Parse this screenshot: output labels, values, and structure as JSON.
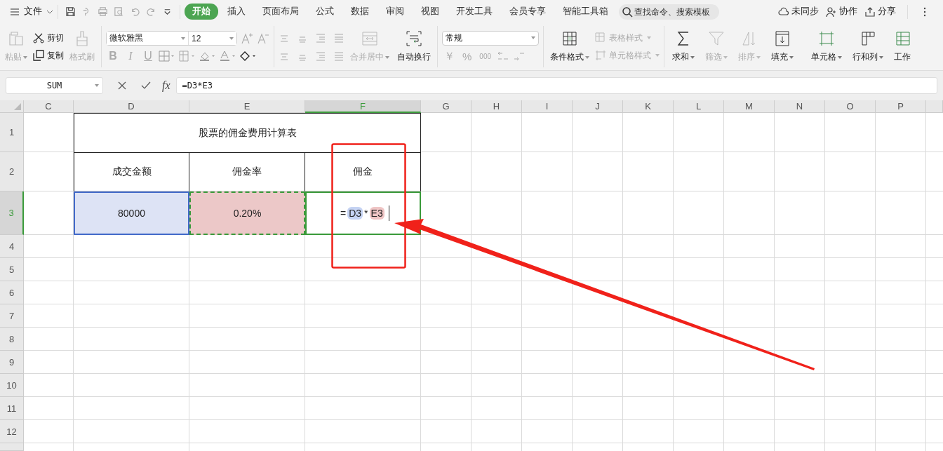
{
  "menu": {
    "label": "文件"
  },
  "tabs": [
    {
      "label": "开始",
      "selected": true
    },
    {
      "label": "插入",
      "selected": false
    },
    {
      "label": "页面布局",
      "selected": false
    },
    {
      "label": "公式",
      "selected": false
    },
    {
      "label": "数据",
      "selected": false
    },
    {
      "label": "审阅",
      "selected": false
    },
    {
      "label": "视图",
      "selected": false
    },
    {
      "label": "开发工具",
      "selected": false
    },
    {
      "label": "会员专享",
      "selected": false
    },
    {
      "label": "智能工具箱",
      "selected": false
    }
  ],
  "search": {
    "placeholder": "查找命令、搜索模板"
  },
  "actions": [
    {
      "label": "未同步"
    },
    {
      "label": "协作"
    },
    {
      "label": "分享"
    }
  ],
  "ribbon": {
    "paste": {
      "label": "粘贴",
      "disabled": true
    },
    "cut": {
      "label": "剪切",
      "disabled": false
    },
    "copy": {
      "label": "复制",
      "disabled": false
    },
    "format_painter": {
      "label": "格式刷",
      "disabled": true
    },
    "font": {
      "value": "微软雅黑"
    },
    "font_size": {
      "value": "12"
    },
    "text_styles": [
      {
        "label": "B",
        "disabled": true
      },
      {
        "label": "I",
        "disabled": true
      },
      {
        "label": "U",
        "disabled": true
      }
    ],
    "merge": {
      "label": "合并居中",
      "disabled": true
    },
    "wrap": {
      "label": "自动换行",
      "disabled": false
    },
    "number_format": {
      "value": "常规"
    },
    "number_buttons": [
      {
        "label": "￥",
        "disabled": true
      },
      {
        "label": "%",
        "disabled": true
      },
      {
        "label": "000",
        "disabled": true
      }
    ],
    "conditional_format": {
      "label": "条件格式",
      "disabled": false
    },
    "table_style": {
      "label": "表格样式",
      "disabled": true
    },
    "cell_style": {
      "label": "单元格样式",
      "disabled": true
    },
    "tools": [
      {
        "kind": "sum",
        "label": "求和",
        "disabled": false
      },
      {
        "kind": "filter",
        "label": "筛选",
        "disabled": true
      },
      {
        "kind": "sort",
        "label": "排序",
        "disabled": true
      },
      {
        "kind": "fill",
        "label": "填充",
        "disabled": false
      },
      {
        "kind": "cell",
        "label": "单元格",
        "disabled": false
      },
      {
        "kind": "rowcol",
        "label": "行和列",
        "disabled": false
      },
      {
        "kind": "sheet",
        "label": "工作",
        "disabled": false
      }
    ]
  },
  "formula_bar": {
    "name_box": "SUM",
    "function_label": "fx",
    "formula": "=D3*E3"
  },
  "sheet": {
    "columns": [
      {
        "label": "C",
        "selected": false
      },
      {
        "label": "D",
        "selected": false
      },
      {
        "label": "E",
        "selected": false
      },
      {
        "label": "F",
        "selected": true
      },
      {
        "label": "G",
        "selected": false
      },
      {
        "label": "H",
        "selected": false
      },
      {
        "label": "I",
        "selected": false
      },
      {
        "label": "J",
        "selected": false
      },
      {
        "label": "K",
        "selected": false
      },
      {
        "label": "L",
        "selected": false
      },
      {
        "label": "M",
        "selected": false
      },
      {
        "label": "N",
        "selected": false
      },
      {
        "label": "O",
        "selected": false
      },
      {
        "label": "P",
        "selected": false
      }
    ],
    "rows": [
      {
        "label": "1",
        "selected": false
      },
      {
        "label": "2",
        "selected": false
      },
      {
        "label": "3",
        "selected": true
      },
      {
        "label": "4",
        "selected": false
      },
      {
        "label": "5",
        "selected": false
      },
      {
        "label": "6",
        "selected": false
      },
      {
        "label": "7",
        "selected": false
      },
      {
        "label": "8",
        "selected": false
      },
      {
        "label": "9",
        "selected": false
      },
      {
        "label": "10",
        "selected": false
      },
      {
        "label": "11",
        "selected": false
      },
      {
        "label": "12",
        "selected": false
      }
    ],
    "table": {
      "title": "股票的佣金费用计算表",
      "headers": [
        "成交金额",
        "佣金率",
        "佣金"
      ],
      "amount": {
        "text": "80000",
        "color": "#dde3f5"
      },
      "rate": {
        "text": "0.20%",
        "color": "#ecc8c8"
      },
      "editing": [
        {
          "kind": "plain",
          "text": "="
        },
        {
          "kind": "ref",
          "text": "D3",
          "color": "#c5d3f3"
        },
        {
          "kind": "plain",
          "text": "*"
        },
        {
          "kind": "ref",
          "text": "E3",
          "color": "#efc5c5"
        }
      ]
    }
  }
}
